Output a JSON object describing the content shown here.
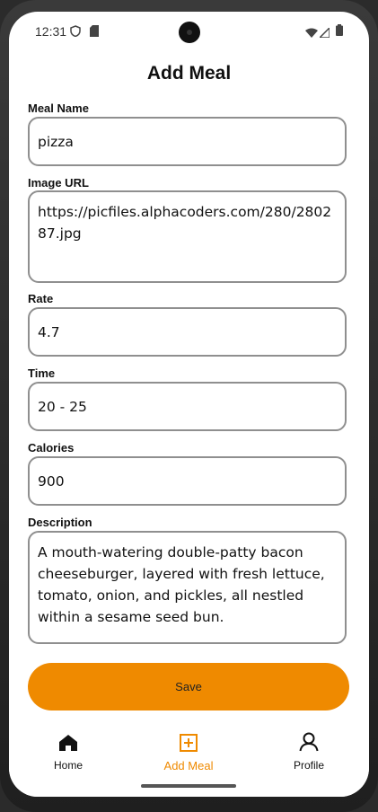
{
  "status_bar": {
    "time": "12:31",
    "icons": [
      "shield-icon",
      "sd-card-icon",
      "wifi-icon",
      "signal-icon",
      "battery-icon"
    ]
  },
  "page": {
    "title": "Add Meal"
  },
  "form": {
    "meal_name": {
      "label": "Meal Name",
      "value": "pizza"
    },
    "image_url": {
      "label": "Image URL",
      "value": "https://picfiles.alphacoders.com/280/280287.jpg"
    },
    "rate": {
      "label": "Rate",
      "value": "4.7"
    },
    "time": {
      "label": "Time",
      "value": "20 - 25"
    },
    "calories": {
      "label": "Calories",
      "value": "900"
    },
    "description": {
      "label": "Description",
      "value": "A mouth-watering double-patty bacon cheeseburger, layered with fresh lettuce, tomato, onion, and pickles, all nestled within a sesame seed bun."
    },
    "save_label": "Save"
  },
  "nav": {
    "items": [
      {
        "label": "Home",
        "icon": "home-icon",
        "active": false
      },
      {
        "label": "Add Meal",
        "icon": "add-box-icon",
        "active": true
      },
      {
        "label": "Profile",
        "icon": "person-icon",
        "active": false
      }
    ]
  },
  "colors": {
    "accent": "#ef8a00",
    "border": "#8f8f8f",
    "text": "#111111"
  }
}
